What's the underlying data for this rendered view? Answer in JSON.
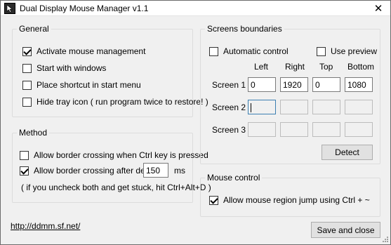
{
  "window": {
    "title": "Dual Display Mouse Manager v1.1",
    "close_glyph": "✕"
  },
  "general": {
    "legend": "General",
    "options": [
      {
        "label": "Activate mouse management",
        "checked": true
      },
      {
        "label": "Start with windows",
        "checked": false
      },
      {
        "label": "Place shortcut in start menu",
        "checked": false
      },
      {
        "label": "Hide tray icon ( run program twice to restore! )",
        "checked": false
      }
    ]
  },
  "method": {
    "legend": "Method",
    "ctrl_crossing": {
      "label": "Allow border crossing when Ctrl key is pressed",
      "checked": false
    },
    "delay_crossing": {
      "label": "Allow border crossing after delay:",
      "checked": true
    },
    "delay_value": "150",
    "delay_unit": "ms",
    "hint": "( if you uncheck both and get stuck, hit Ctrl+Alt+D )"
  },
  "screens": {
    "legend": "Screens boundaries",
    "automatic_control": {
      "label": "Automatic control",
      "checked": false
    },
    "use_preview": {
      "label": "Use preview",
      "checked": false
    },
    "columns": [
      "Left",
      "Right",
      "Top",
      "Bottom"
    ],
    "rows": [
      {
        "label": "Screen 1",
        "values": [
          "0",
          "1920",
          "0",
          "1080"
        ],
        "enabled": true
      },
      {
        "label": "Screen 2",
        "values": [
          "",
          "",
          "",
          ""
        ],
        "enabled": false
      },
      {
        "label": "Screen 3",
        "values": [
          "",
          "",
          "",
          ""
        ],
        "enabled": false
      }
    ],
    "detect_label": "Detect"
  },
  "mouse_control": {
    "legend": "Mouse control",
    "region_jump": {
      "label": "Allow mouse region jump using Ctrl + ~",
      "checked": true
    }
  },
  "footer": {
    "link": "http://ddmm.sf.net/",
    "save_close_label": "Save and close"
  },
  "icons": {
    "app": "mouse-icon",
    "close": "close-icon",
    "resize": "resize-grip-icon"
  }
}
